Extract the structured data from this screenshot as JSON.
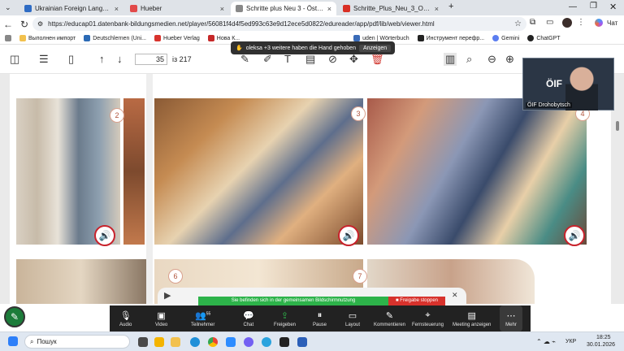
{
  "browser": {
    "tabs": [
      {
        "title": "Ukrainian Foreign Language Educ",
        "color": "#2f6cc4"
      },
      {
        "title": "Hueber",
        "color": "#e24a4a"
      },
      {
        "title": "Schritte plus Neu 3 - Österreich -",
        "color": "#888888"
      },
      {
        "title": "Schritte_Plus_Neu_3_Oesterreich...",
        "color": "#d93025"
      }
    ],
    "new_tab": "+",
    "url": "https://educap01.datenbank-bildungsmedien.net/player/56081f4d4f5ed993c63e9d12ece5d0822/edureader/app/pdf/lib/web/viewer.html",
    "chat_label": "Чат"
  },
  "bookmarks": [
    {
      "label": "Выполнен импорт",
      "color": "#6b6b6b"
    },
    {
      "label": "Deutschlernen (Uni...",
      "color": "#2b6ab5"
    },
    {
      "label": "Hueber Verlag",
      "color": "#d8332d"
    },
    {
      "label": "Нова К...",
      "color": "#c62828"
    },
    {
      "label": "uden | Wörterbuch",
      "color": "#3a6bb8"
    },
    {
      "label": "Инструмент перефр...",
      "color": "#222222"
    },
    {
      "label": "Gemini",
      "color": "#5b7df0"
    },
    {
      "label": "ChatGPT",
      "color": "#222222"
    }
  ],
  "pdf": {
    "page": "35",
    "total": "із 217"
  },
  "notification": {
    "text": "oleksa +3 weitere haben die Hand gehoben",
    "button": "Anzeigen"
  },
  "photos": [
    {
      "num": "2"
    },
    {
      "num": "3"
    },
    {
      "num": "4"
    },
    {
      "num": "6"
    },
    {
      "num": "7"
    }
  ],
  "video_tile": {
    "name": "ÖIF Drohobytsch",
    "logo": "ÖIF"
  },
  "share_bar": {
    "text": "Sie befinden sich in der gemeinsamen Bildschirmnutzung",
    "stop": "Freigabe stoppen"
  },
  "zoom": {
    "participants_count": "55",
    "items": [
      {
        "label": "Audio"
      },
      {
        "label": "Video"
      },
      {
        "label": "Teilnehmer"
      },
      {
        "label": "Chat"
      },
      {
        "label": "Freigeben"
      },
      {
        "label": "Pause"
      },
      {
        "label": "Layout"
      },
      {
        "label": "Kommentieren"
      },
      {
        "label": "Fernsteuerung"
      },
      {
        "label": "Meeting anzeigen"
      },
      {
        "label": "Mehr"
      }
    ]
  },
  "taskbar": {
    "search": "Пошук",
    "lang": "УКР",
    "time": "18:25",
    "date": "30.01.2026"
  },
  "colors": {
    "accent_green": "#2db34a",
    "stop_red": "#d7322c",
    "zoom_bar": "#222222",
    "speaker_red": "#c8232c"
  }
}
